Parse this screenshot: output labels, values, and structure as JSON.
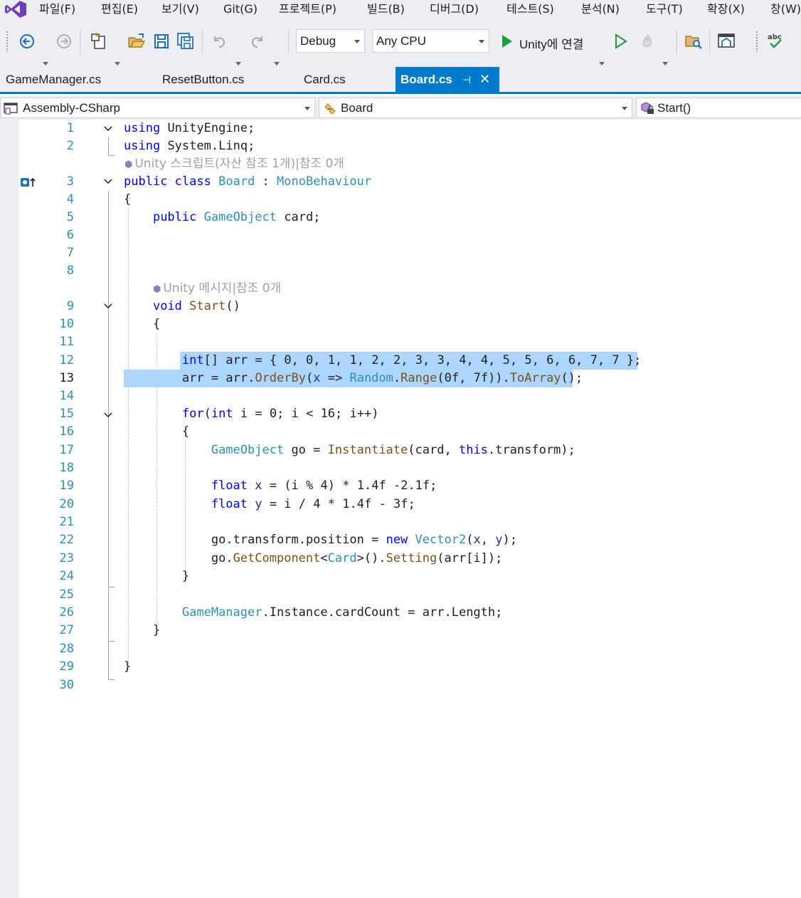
{
  "menu": [
    "파일(F)",
    "편집(E)",
    "보기(V)",
    "Git(G)",
    "프로젝트(P)",
    "빌드(B)",
    "디버그(D)",
    "테스트(S)",
    "분석(N)",
    "도구(T)",
    "확장(X)",
    "창(W)"
  ],
  "toolbar": {
    "configuration": "Debug",
    "platform": "Any CPU",
    "run_label": "Unity에 연결"
  },
  "tabs": [
    {
      "label": "GameManager.cs",
      "active": false
    },
    {
      "label": "ResetButton.cs",
      "active": false
    },
    {
      "label": "Card.cs",
      "active": false
    },
    {
      "label": "Board.cs",
      "active": true
    }
  ],
  "tab_pin_glyph": "⊣",
  "tab_close_glyph": "✕",
  "nav": {
    "project": "Assembly-CSharp",
    "type": "Board",
    "member": "Start()"
  },
  "editor": {
    "current_line": 13,
    "lens_class": "Unity 스크립트(자산 참조 1개)|참조 0개",
    "lens_method": "Unity 메시지|참조 0개",
    "line_numbers": [
      "1",
      "2",
      "3",
      "4",
      "5",
      "6",
      "7",
      "8",
      "9",
      "10",
      "11",
      "12",
      "13",
      "14",
      "15",
      "16",
      "17",
      "18",
      "19",
      "20",
      "21",
      "22",
      "23",
      "24",
      "25",
      "26",
      "27",
      "28",
      "29",
      "30"
    ],
    "code_lines": [
      "using UnityEngine;",
      "using System.Linq;",
      "public class Board : MonoBehaviour",
      "{",
      "    public GameObject card;",
      "",
      "",
      "",
      "    void Start()",
      "    {",
      "",
      "        int[] arr = { 0, 0, 1, 1, 2, 2, 3, 3, 4, 4, 5, 5, 6, 6, 7, 7 };",
      "        arr = arr.OrderBy(x => Random.Range(0f, 7f)).ToArray();",
      "",
      "        for(int i = 0; i < 16; i++)",
      "        {",
      "            GameObject go = Instantiate(card, this.transform);",
      "",
      "            float x = (i % 4) * 1.4f -2.1f;",
      "            float y = i / 4 * 1.4f - 3f;",
      "",
      "            go.transform.position = new Vector2(x, y);",
      "            go.GetComponent<Card>().Setting(arr[i]);",
      "        }",
      "",
      "        GameManager.Instance.cardCount = arr.Length;",
      "    }",
      "",
      "}",
      ""
    ]
  },
  "colors": {
    "accent": "#007acc",
    "keyword": "#0000ff",
    "type": "#2b91af",
    "method": "#74531f",
    "selection": "#add6ff",
    "chrome": "#eeeef2"
  }
}
